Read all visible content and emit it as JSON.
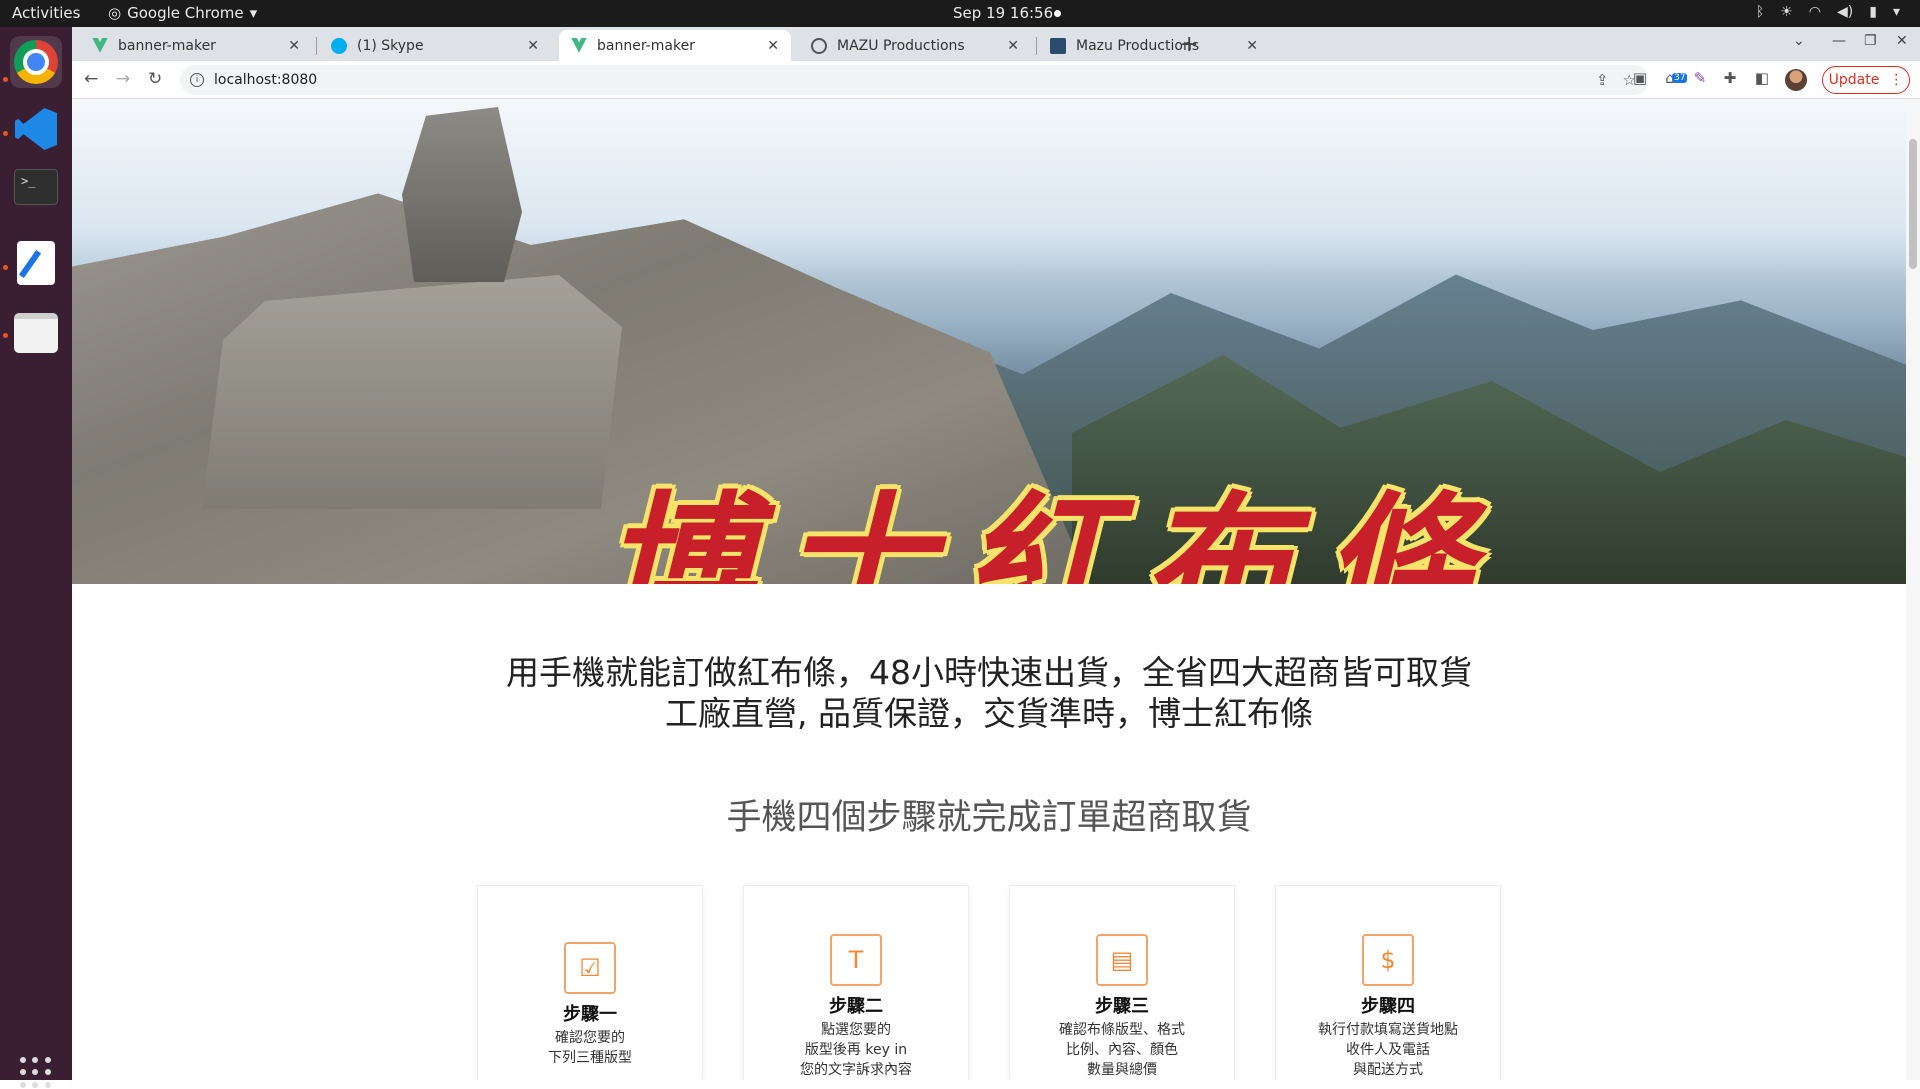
{
  "system": {
    "activities": "Activities",
    "app_name": "Google Chrome",
    "clock": "Sep 19  16:56"
  },
  "browser": {
    "tabs": [
      {
        "title": "banner-maker",
        "icon": "vue-icon",
        "active": false
      },
      {
        "title": "(1) Skype",
        "icon": "skype-icon",
        "active": false
      },
      {
        "title": "banner-maker",
        "icon": "vue-icon",
        "active": true
      },
      {
        "title": "MAZU Productions",
        "icon": "globe-icon",
        "active": false
      },
      {
        "title": "Mazu Productions",
        "icon": "mazu-icon",
        "active": false
      }
    ],
    "url": "localhost:8080",
    "update_label": "Update",
    "extension_badge": "37"
  },
  "page": {
    "hero_title": "博士紅布條",
    "tagline_1": "用手機就能訂做紅布條，48小時快速出貨，全省四大超商皆可取貨",
    "tagline_2": "工廠直營, 品質保證，交貨準時，博士紅布條",
    "steps_heading": "手機四個步驟就完成訂單超商取貨",
    "steps": [
      {
        "title": "步驟一",
        "desc": "確認您要的\n下列三種版型",
        "icon": "document-check-icon"
      },
      {
        "title": "步驟二",
        "desc": "點選您要的\n版型後再 key in\n您的文字訴求內容",
        "icon": "text-edit-icon"
      },
      {
        "title": "步驟三",
        "desc": "確認布條版型、格式\n比例、內容、顏色\n數量與總價",
        "icon": "layout-check-icon"
      },
      {
        "title": "步驟四",
        "desc": "執行付款填寫送貨地點\n收件人及電話\n與配送方式",
        "icon": "home-dollar-icon"
      }
    ]
  },
  "colors": {
    "hero_title": "#c8202a",
    "hero_outline": "#f5e36a",
    "step_icon": "#f08a3a",
    "update_button": "#d93025"
  }
}
